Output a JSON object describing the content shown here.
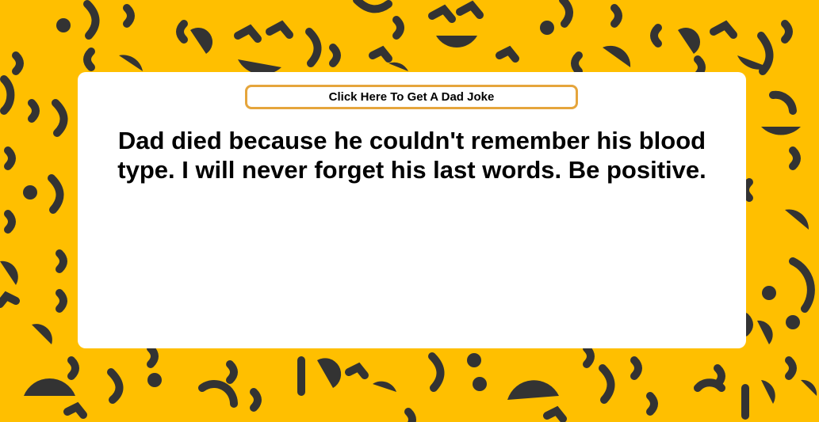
{
  "theme": {
    "background": "#ffbf00",
    "pattern_color": "#333333",
    "card_background": "#ffffff",
    "button_border": "#e5a53c"
  },
  "background_pattern": {
    "icon": "smiley-face-pattern"
  },
  "button": {
    "label": "Click Here To Get A Dad Joke"
  },
  "joke": {
    "text": "Dad died because he couldn't remember his blood type. I will never forget his last words. Be positive."
  }
}
